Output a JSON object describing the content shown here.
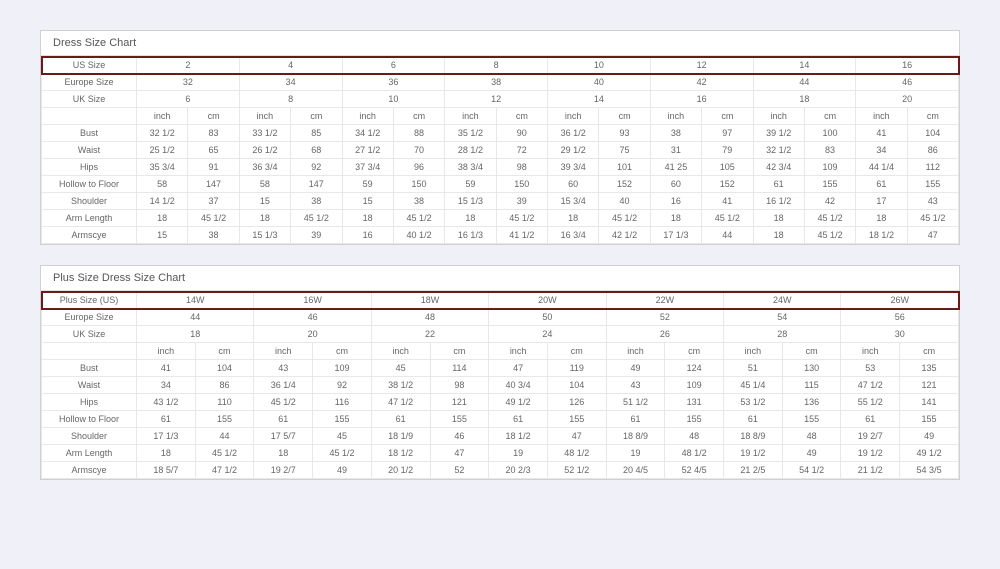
{
  "chart1": {
    "title": "Dress Size Chart",
    "primaryRow": {
      "label": "US Size",
      "values": [
        "2",
        "4",
        "6",
        "8",
        "10",
        "12",
        "14",
        "16"
      ]
    },
    "spanRows": [
      {
        "label": "Europe Size",
        "values": [
          "32",
          "34",
          "36",
          "38",
          "40",
          "42",
          "44",
          "46"
        ]
      },
      {
        "label": "UK Size",
        "values": [
          "6",
          "8",
          "10",
          "12",
          "14",
          "16",
          "18",
          "20"
        ]
      }
    ],
    "unitRow": [
      "inch",
      "cm",
      "inch",
      "cm",
      "inch",
      "cm",
      "inch",
      "cm",
      "inch",
      "cm",
      "inch",
      "cm",
      "inch",
      "cm",
      "inch",
      "cm"
    ],
    "dataRows": [
      {
        "label": "Bust",
        "values": [
          "32 1/2",
          "83",
          "33 1/2",
          "85",
          "34 1/2",
          "88",
          "35 1/2",
          "90",
          "36 1/2",
          "93",
          "38",
          "97",
          "39 1/2",
          "100",
          "41",
          "104"
        ]
      },
      {
        "label": "Waist",
        "values": [
          "25 1/2",
          "65",
          "26 1/2",
          "68",
          "27 1/2",
          "70",
          "28 1/2",
          "72",
          "29 1/2",
          "75",
          "31",
          "79",
          "32 1/2",
          "83",
          "34",
          "86"
        ]
      },
      {
        "label": "Hips",
        "values": [
          "35 3/4",
          "91",
          "36 3/4",
          "92",
          "37 3/4",
          "96",
          "38 3/4",
          "98",
          "39 3/4",
          "101",
          "41 25",
          "105",
          "42 3/4",
          "109",
          "44 1/4",
          "112"
        ]
      },
      {
        "label": "Hollow to Floor",
        "values": [
          "58",
          "147",
          "58",
          "147",
          "59",
          "150",
          "59",
          "150",
          "60",
          "152",
          "60",
          "152",
          "61",
          "155",
          "61",
          "155"
        ]
      },
      {
        "label": "Shoulder",
        "values": [
          "14 1/2",
          "37",
          "15",
          "38",
          "15",
          "38",
          "15 1/3",
          "39",
          "15 3/4",
          "40",
          "16",
          "41",
          "16 1/2",
          "42",
          "17",
          "43"
        ]
      },
      {
        "label": "Arm Length",
        "values": [
          "18",
          "45 1/2",
          "18",
          "45 1/2",
          "18",
          "45 1/2",
          "18",
          "45 1/2",
          "18",
          "45 1/2",
          "18",
          "45 1/2",
          "18",
          "45 1/2",
          "18",
          "45 1/2"
        ]
      },
      {
        "label": "Armscye",
        "values": [
          "15",
          "38",
          "15 1/3",
          "39",
          "16",
          "40 1/2",
          "16 1/3",
          "41 1/2",
          "16 3/4",
          "42 1/2",
          "17 1/3",
          "44",
          "18",
          "45 1/2",
          "18 1/2",
          "47"
        ]
      }
    ]
  },
  "chart2": {
    "title": "Plus Size Dress Size Chart",
    "primaryRow": {
      "label": "Plus Size (US)",
      "values": [
        "14W",
        "16W",
        "18W",
        "20W",
        "22W",
        "24W",
        "26W"
      ]
    },
    "spanRows": [
      {
        "label": "Europe Size",
        "values": [
          "44",
          "46",
          "48",
          "50",
          "52",
          "54",
          "56"
        ]
      },
      {
        "label": "UK Size",
        "values": [
          "18",
          "20",
          "22",
          "24",
          "26",
          "28",
          "30"
        ]
      }
    ],
    "unitRow": [
      "inch",
      "cm",
      "inch",
      "cm",
      "inch",
      "cm",
      "inch",
      "cm",
      "inch",
      "cm",
      "inch",
      "cm",
      "inch",
      "cm"
    ],
    "dataRows": [
      {
        "label": "Bust",
        "values": [
          "41",
          "104",
          "43",
          "109",
          "45",
          "114",
          "47",
          "119",
          "49",
          "124",
          "51",
          "130",
          "53",
          "135"
        ]
      },
      {
        "label": "Waist",
        "values": [
          "34",
          "86",
          "36 1/4",
          "92",
          "38 1/2",
          "98",
          "40 3/4",
          "104",
          "43",
          "109",
          "45 1/4",
          "115",
          "47 1/2",
          "121"
        ]
      },
      {
        "label": "Hips",
        "values": [
          "43 1/2",
          "110",
          "45 1/2",
          "116",
          "47 1/2",
          "121",
          "49 1/2",
          "126",
          "51 1/2",
          "131",
          "53 1/2",
          "136",
          "55 1/2",
          "141"
        ]
      },
      {
        "label": "Hollow to Floor",
        "values": [
          "61",
          "155",
          "61",
          "155",
          "61",
          "155",
          "61",
          "155",
          "61",
          "155",
          "61",
          "155",
          "61",
          "155"
        ]
      },
      {
        "label": "Shoulder",
        "values": [
          "17 1/3",
          "44",
          "17 5/7",
          "45",
          "18 1/9",
          "46",
          "18 1/2",
          "47",
          "18 8/9",
          "48",
          "18 8/9",
          "48",
          "19 2/7",
          "49"
        ]
      },
      {
        "label": "Arm Length",
        "values": [
          "18",
          "45 1/2",
          "18",
          "45 1/2",
          "18 1/2",
          "47",
          "19",
          "48 1/2",
          "19",
          "48 1/2",
          "19 1/2",
          "49",
          "19 1/2",
          "49 1/2"
        ]
      },
      {
        "label": "Armscye",
        "values": [
          "18 5/7",
          "47 1/2",
          "19 2/7",
          "49",
          "20 1/2",
          "52",
          "20 2/3",
          "52 1/2",
          "20 4/5",
          "52 4/5",
          "21 2/5",
          "54 1/2",
          "21 1/2",
          "54 3/5"
        ]
      }
    ]
  }
}
